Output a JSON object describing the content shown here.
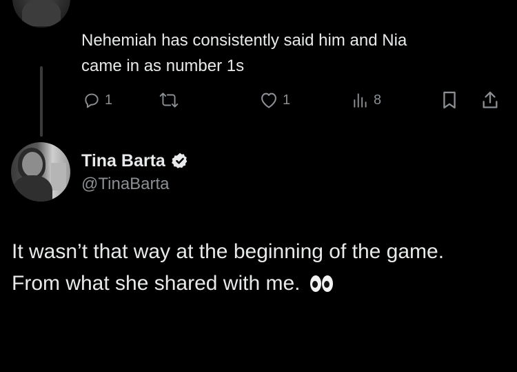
{
  "previous_tweet": {
    "avatar_icon": "profile-photo-icon",
    "text_line1": "Nehemiah has consistently said him and Nia",
    "text_line2": "came in as number 1s",
    "actions": {
      "reply_count": "1",
      "retweet_count": "",
      "like_count": "1",
      "views_count": "8"
    }
  },
  "tweet": {
    "display_name": "Tina Barta",
    "verified": true,
    "handle": "@TinaBarta",
    "text_line1": "It wasn’t that way at the beginning of the game.",
    "text_line2": "From what she shared with me.",
    "emoji": "eyes-emoji"
  },
  "colors": {
    "background": "#000000",
    "text_primary": "#e7e9ea",
    "text_secondary": "#8b8f93",
    "thread_line": "#3a3a3a"
  }
}
